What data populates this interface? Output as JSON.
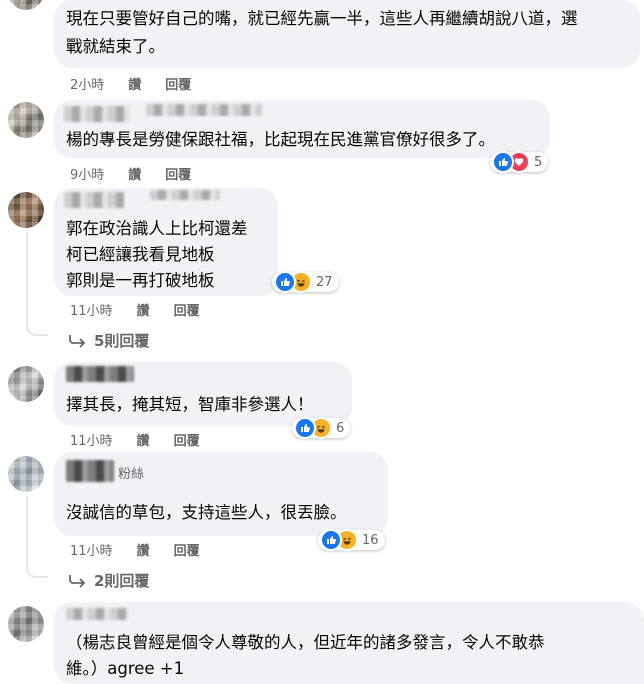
{
  "comments": [
    {
      "id": "c1",
      "body_lines": [
        "現在只要管好自己的嘴，就已經先贏一半，這些人再繼續胡說八道，選",
        "戰就結束了。"
      ],
      "time": "2小時",
      "like": "讚",
      "reply": "回覆"
    },
    {
      "id": "c2",
      "body_lines": [
        "楊的專長是勞健保跟社福，比起現在民進黨官僚好很多了。"
      ],
      "time": "9小時",
      "like": "讚",
      "reply": "回覆",
      "reactions": {
        "icons": [
          "like-icon",
          "love-icon"
        ],
        "count": "5"
      }
    },
    {
      "id": "c3",
      "body_lines": [
        "郭在政治識人上比柯還差",
        "柯已經讓我看見地板",
        "郭則是一再打破地板"
      ],
      "time": "11小時",
      "like": "讚",
      "reply": "回覆",
      "reactions": {
        "icons": [
          "like-icon",
          "haha-icon"
        ],
        "count": "27"
      },
      "replies_link": "5則回覆"
    },
    {
      "id": "c4",
      "body_lines": [
        "擇其長，掩其短，智庫非參選人！"
      ],
      "time": "11小時",
      "like": "讚",
      "reply": "回覆",
      "reactions": {
        "icons": [
          "like-icon",
          "haha-icon"
        ],
        "count": "6"
      }
    },
    {
      "id": "c5",
      "badge": "粉絲",
      "body_lines": [
        "沒誠信的草包，支持這些人，很丟臉。"
      ],
      "time": "11小時",
      "like": "讚",
      "reply": "回覆",
      "reactions": {
        "icons": [
          "like-icon",
          "haha-icon"
        ],
        "count": "16"
      },
      "replies_link": "2則回覆"
    },
    {
      "id": "c6",
      "body_lines": [
        "（楊志良曾經是個令人尊敬的人，但近年的諸多發言，令人不敢恭",
        "維。）agree +1"
      ]
    }
  ],
  "colors": {
    "bubble": "#f0f2f5",
    "meta_text": "#65676b",
    "like_blue": "#1877f2",
    "love_red": "#f33e58",
    "haha_yellow": "#f7b125"
  }
}
